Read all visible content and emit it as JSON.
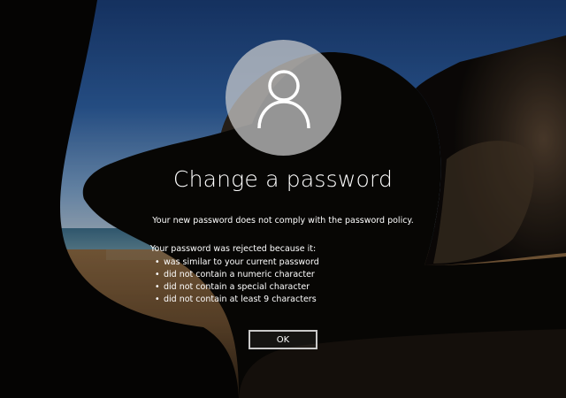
{
  "screen": {
    "title": "Change a password",
    "policy_message": "Your new password does not comply with the password policy.",
    "rejection_intro": "Your password was rejected because it:",
    "reasons": [
      "was similar to your current password",
      "did not contain a numeric character",
      "did not contain a special character",
      "did not contain at least 9 characters"
    ],
    "bullet": "•",
    "ok_label": "OK"
  },
  "icons": {
    "avatar": "user-icon"
  },
  "colors": {
    "text": "#ffffff",
    "avatar_circle": "#cdcdcd",
    "button_border": "#c9c9c9"
  }
}
